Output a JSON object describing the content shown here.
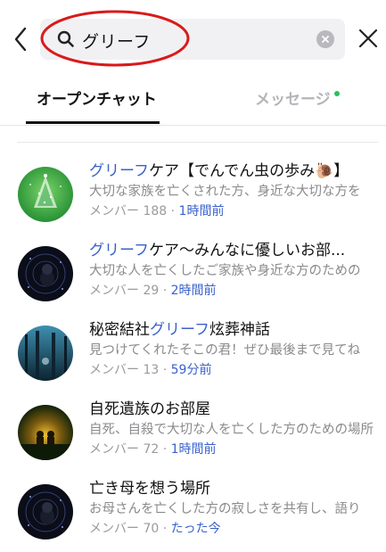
{
  "header": {
    "back_icon": "chevron-left-icon",
    "search_query": "グリーフ",
    "search_icon": "search-icon",
    "clear_icon": "clear-circle-icon",
    "close_icon": "close-icon"
  },
  "tabs": [
    {
      "label": "オープンチャット",
      "active": true
    },
    {
      "label": "メッセージ",
      "active": false,
      "badge": "green-dot"
    }
  ],
  "results": [
    {
      "title_highlight": "グリーフ",
      "title_rest": "ケア【でんでん虫の歩み🐌】",
      "title_prefix": "",
      "description": "大切な家族を亡くされた方、身近な大切な方を",
      "member_label": "メンバー",
      "member_count": "188",
      "time": "1時間前",
      "avatar": "christmas-tree"
    },
    {
      "title_highlight": "グリーフ",
      "title_rest": "ケア〜みんなに優しいお部...",
      "title_prefix": "",
      "description": "大切な人を亡くしたご家族や身近な方のための",
      "member_label": "メンバー",
      "member_count": "29",
      "time": "2時間前",
      "avatar": "dark-portrait"
    },
    {
      "title_prefix": "秘密結社",
      "title_highlight": "グリーフ",
      "title_rest": "炫葬神話",
      "description": "見つけてくれたそこの君！ぜひ最後まで見てね",
      "member_label": "メンバー",
      "member_count": "13",
      "time": "59分前",
      "avatar": "blue-forest"
    },
    {
      "title_prefix": "自死遺族のお部屋",
      "title_highlight": "",
      "title_rest": "",
      "description": "自死、自殺で大切な人を亡くした方のための場所",
      "member_label": "メンバー",
      "member_count": "72",
      "time": "1時間前",
      "avatar": "sunset-couple"
    },
    {
      "title_prefix": "亡き母を想う場所",
      "title_highlight": "",
      "title_rest": "",
      "description": "お母さんを亡くした方の寂しさを共有し、語り",
      "member_label": "メンバー",
      "member_count": "70",
      "time": "たった今",
      "avatar": "dark-portrait"
    }
  ],
  "colors": {
    "highlight": "#3a61cc",
    "annotation_circle": "#d91a1a",
    "active_tab": "#111111",
    "inactive_tab": "#b4b4b8"
  }
}
